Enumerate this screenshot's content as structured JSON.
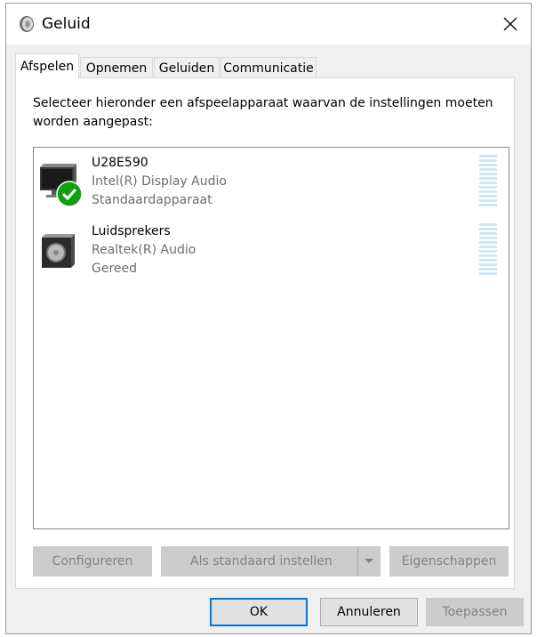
{
  "window": {
    "title": "Geluid",
    "close_label": "×"
  },
  "tabs": [
    {
      "label": "Afspelen",
      "active": true
    },
    {
      "label": "Opnemen",
      "active": false
    },
    {
      "label": "Geluiden",
      "active": false
    },
    {
      "label": "Communicatie",
      "active": false
    }
  ],
  "panel": {
    "instruction": "Selecteer hieronder een afspeelapparaat waarvan de instellingen moeten worden aangepast:"
  },
  "devices": [
    {
      "name": "U28E590",
      "driver": "Intel(R) Display Audio",
      "status": "Standaardapparaat",
      "icon": "monitor-icon",
      "default": true
    },
    {
      "name": "Luidsprekers",
      "driver": "Realtek(R) Audio",
      "status": "Gereed",
      "icon": "speaker-icon",
      "default": false
    }
  ],
  "panel_buttons": {
    "configure": "Configureren",
    "set_default": "Als standaard instellen",
    "properties": "Eigenschappen"
  },
  "dialog_buttons": {
    "ok": "OK",
    "cancel": "Annuleren",
    "apply": "Toepassen"
  },
  "colors": {
    "accent": "#0078d7",
    "default_check": "#11a011",
    "vu_meter": "#cfe7f2"
  }
}
